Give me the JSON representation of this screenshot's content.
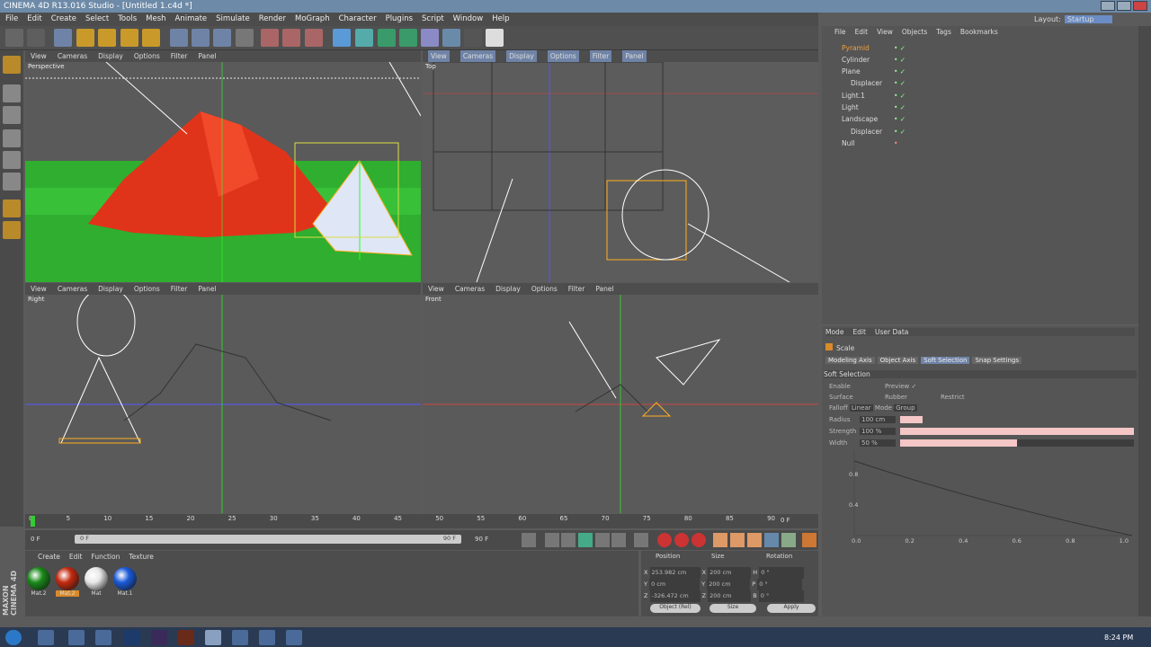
{
  "window": {
    "title": "CINEMA 4D R13.016 Studio - [Untitled 1.c4d *]"
  },
  "menu": [
    "File",
    "Edit",
    "Create",
    "Select",
    "Tools",
    "Mesh",
    "Animate",
    "Simulate",
    "Render",
    "MoGraph",
    "Character",
    "Plugins",
    "Script",
    "Window",
    "Help"
  ],
  "layout": {
    "label": "Layout:",
    "value": "Startup"
  },
  "viewport_menu": [
    "View",
    "Cameras",
    "Display",
    "Options",
    "Filter",
    "Panel"
  ],
  "viewports": {
    "perspective": "Perspective",
    "top": "Top",
    "right": "Right",
    "front": "Front"
  },
  "objects_menu": [
    "File",
    "Edit",
    "View",
    "Objects",
    "Tags",
    "Bookmarks"
  ],
  "objects": [
    {
      "name": "Pyramid",
      "indent": 0,
      "selected": true
    },
    {
      "name": "Cylinder",
      "indent": 0
    },
    {
      "name": "Plane",
      "indent": 0
    },
    {
      "name": "Displacer",
      "indent": 1
    },
    {
      "name": "Light.1",
      "indent": 0
    },
    {
      "name": "Light",
      "indent": 0
    },
    {
      "name": "Landscape",
      "indent": 0
    },
    {
      "name": "Displacer",
      "indent": 1
    },
    {
      "name": "Null",
      "indent": 0
    }
  ],
  "attributes": {
    "menu": [
      "Mode",
      "Edit",
      "User Data"
    ],
    "title": "Scale",
    "tabs": [
      "Modeling Axis",
      "Object Axis",
      "Soft Selection",
      "Snap Settings"
    ],
    "section": "Soft Selection",
    "enable": "Enable",
    "preview": "Preview ✓",
    "surface": "Surface",
    "rubber": "Rubber",
    "restrict": "Restrict",
    "falloff_label": "Falloff",
    "falloff_value": "Linear",
    "mode_label": "Mode",
    "mode_value": "Group",
    "radius_label": "Radius",
    "radius_value": "100 cm",
    "strength_label": "Strength",
    "strength_value": "100 %",
    "strength_fill": 1.0,
    "width_label": "Width",
    "width_value": "50 %",
    "width_fill": 0.5,
    "graph_y": [
      "0.8",
      "0.4"
    ],
    "graph_x": [
      "0.0",
      "0.2",
      "0.4",
      "0.6",
      "0.8",
      "1.0"
    ]
  },
  "timeline": {
    "ticks": [
      "0",
      "5",
      "10",
      "15",
      "20",
      "25",
      "30",
      "35",
      "40",
      "45",
      "50",
      "55",
      "60",
      "65",
      "70",
      "75",
      "80",
      "85",
      "90"
    ],
    "end": "0 F"
  },
  "playback": {
    "current": "0 F",
    "range_start": "0 F",
    "range_end": "90 F",
    "max": "90 F"
  },
  "materials": {
    "menu": [
      "Create",
      "Edit",
      "Function",
      "Texture"
    ],
    "items": [
      {
        "name": "Mat.2",
        "color": "#1a8a1a"
      },
      {
        "name": "Mat.2",
        "color": "#c42a10"
      },
      {
        "name": "Mat",
        "color": "#e8e8e8"
      },
      {
        "name": "Mat.1",
        "color": "#1a5ad8"
      }
    ]
  },
  "coords": {
    "headers": [
      "Position",
      "Size",
      "Rotation"
    ],
    "rows": [
      {
        "axis": "X",
        "pos": "253.982 cm",
        "saxis": "X",
        "size": "200 cm",
        "raxis": "H",
        "rot": "0 °"
      },
      {
        "axis": "Y",
        "pos": "0 cm",
        "saxis": "Y",
        "size": "200 cm",
        "raxis": "P",
        "rot": "0 °"
      },
      {
        "axis": "Z",
        "pos": "-326.472 cm",
        "saxis": "Z",
        "size": "200 cm",
        "raxis": "B",
        "rot": "0 °"
      }
    ],
    "mode": "Object (Rel)",
    "size_mode": "Size",
    "apply": "Apply"
  },
  "brand": "MAXON CINEMA 4D",
  "clock": "8:24 PM"
}
